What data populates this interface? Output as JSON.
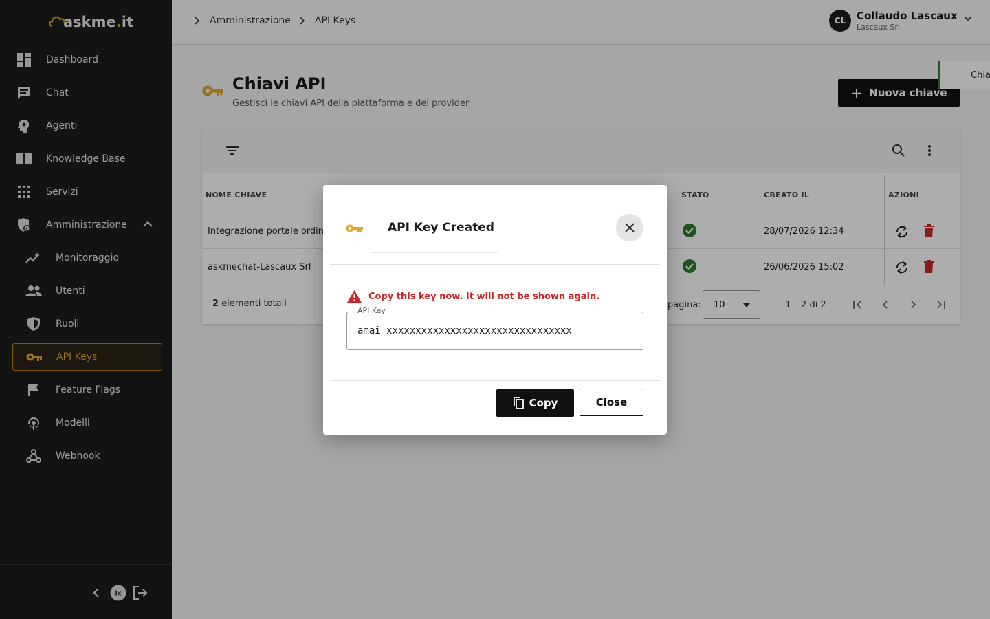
{
  "app": {
    "logo": "askme",
    "logo_dot": ".",
    "logo_tld": "it"
  },
  "sidebar": {
    "items": [
      {
        "label": "Dashboard",
        "icon": "dashboard-icon"
      },
      {
        "label": "Chat",
        "icon": "chat-icon"
      },
      {
        "label": "Agenti",
        "icon": "agent-head-icon"
      },
      {
        "label": "Knowledge Base",
        "icon": "book-icon"
      },
      {
        "label": "Servizi",
        "icon": "grid-icon"
      },
      {
        "label": "Amministrazione",
        "icon": "admin-gear-icon",
        "expanded": true
      },
      {
        "label": "Monitoraggio",
        "icon": "monitoring-icon"
      },
      {
        "label": "Utenti",
        "icon": "users-icon"
      },
      {
        "label": "Ruoli",
        "icon": "shield-icon"
      },
      {
        "label": "API Keys",
        "icon": "key-icon",
        "active": true
      },
      {
        "label": "Feature Flags",
        "icon": "flag-icon"
      },
      {
        "label": "Modelli",
        "icon": "model-icon"
      },
      {
        "label": "Webhook",
        "icon": "webhook-icon"
      }
    ],
    "footer_logo": "lx"
  },
  "header": {
    "breadcrumb": [
      "Amministrazione",
      "API Keys"
    ],
    "user": {
      "initials": "CL",
      "name": "Collaudo Lascaux",
      "org": "Lascaux Srl"
    }
  },
  "page": {
    "title": "Chiavi API",
    "subtitle": "Gestisci le chiavi API della piattaforma e dei provider",
    "new_button": "Nuova chiave",
    "new_button_icon": "+",
    "toast_text": "Chiave"
  },
  "table": {
    "columns": [
      "NOME CHIAVE",
      "STATO",
      "CREATO IL",
      "AZIONI"
    ],
    "rows": [
      {
        "name": "Integrazione portale ordini",
        "status": "active",
        "created": "28/07/2026 12:34"
      },
      {
        "name": "askmechat-Lascaux Srl",
        "status": "active",
        "created": "26/06/2026 15:02"
      }
    ],
    "total_count": "2",
    "total_label": "elementi totali",
    "per_page_label": "pagina:",
    "per_page": "10",
    "range": "1 – 2 di 2"
  },
  "modal": {
    "title": "API Key Created",
    "warning": "Copy this key now. It will not be shown again.",
    "field_label": "API Key",
    "field_value": "amai_xxxxxxxxxxxxxxxxxxxxxxxxxxxxxxxx",
    "copy_label": "Copy",
    "close_label": "Close"
  },
  "colors": {
    "accent": "#e0a82e",
    "sidebar_bg": "#1c1c1c",
    "warn": "#c62828",
    "success": "#2e7d32",
    "delete": "#c62828"
  }
}
